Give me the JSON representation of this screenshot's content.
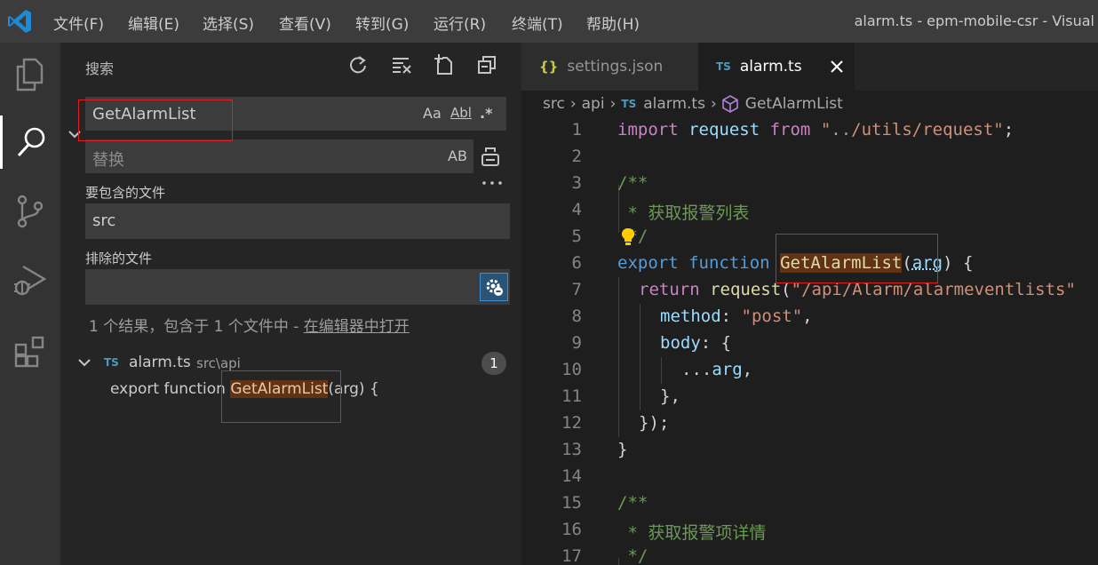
{
  "titlebar": {
    "menu": [
      "文件(F)",
      "编辑(E)",
      "选择(S)",
      "查看(V)",
      "转到(G)",
      "运行(R)",
      "终端(T)",
      "帮助(H)"
    ],
    "window_title": "alarm.ts - epm-mobile-csr - Visual"
  },
  "sidebar": {
    "title": "搜索",
    "search_value": "GetAlarmList",
    "search_options": {
      "match_case": "Aa",
      "whole_word": "Abl",
      "regex": ".*"
    },
    "replace_placeholder": "替换",
    "preserve_case": "AB",
    "include_label": "要包含的文件",
    "include_value": "src",
    "exclude_label": "排除的文件",
    "exclude_value": "",
    "results_message": "1 个结果，包含于 1 个文件中 - ",
    "open_in_editor": "在编辑器中打开",
    "result_file": {
      "badge": "TS",
      "name": "alarm.ts",
      "path": "src\\api",
      "count": "1"
    },
    "match": {
      "before": "export function ",
      "match": "GetAlarmList",
      "after": "(arg) {"
    }
  },
  "editor": {
    "tabs": [
      {
        "icon": "{}",
        "label": "settings.json"
      },
      {
        "icon": "TS",
        "label": "alarm.ts"
      }
    ],
    "breadcrumb": {
      "seg1": "src",
      "seg2": "api",
      "badge": "TS",
      "seg3": "alarm.ts",
      "seg4": "GetAlarmList"
    },
    "lines": [
      {
        "n": "1",
        "t": {
          "a": "import",
          "b": " request ",
          "c": "from",
          "d": " ",
          "e": "\"../utils/request\"",
          "f": ";"
        }
      },
      {
        "n": "2"
      },
      {
        "n": "3",
        "t": "/**"
      },
      {
        "n": "4",
        "t": " * 获取报警列表"
      },
      {
        "n": "5",
        "t": " */"
      },
      {
        "n": "6",
        "t": {
          "a": "export",
          "b": " ",
          "c": "function",
          "d": " ",
          "e": "GetAlarmList",
          "f": "(",
          "g": "arg",
          "h": ") {"
        }
      },
      {
        "n": "7",
        "t": {
          "a": "return",
          "b": " ",
          "c": "request",
          "d": "(",
          "e": "\"/api/Alarm/alarmeventlists\""
        }
      },
      {
        "n": "8",
        "t": {
          "a": "method",
          "b": ": ",
          "c": "\"post\"",
          "d": ","
        }
      },
      {
        "n": "9",
        "t": {
          "a": "body",
          "b": ": {"
        }
      },
      {
        "n": "10",
        "t": {
          "a": "...",
          "b": "arg",
          "c": ","
        }
      },
      {
        "n": "11",
        "t": "},"
      },
      {
        "n": "12",
        "t": "});"
      },
      {
        "n": "13",
        "t": "}"
      },
      {
        "n": "14"
      },
      {
        "n": "15",
        "t": "/**"
      },
      {
        "n": "16",
        "t": " * 获取报警项详情"
      },
      {
        "n": "17",
        "t": " */"
      }
    ]
  },
  "colors": {
    "accent": "#007acc",
    "highlight": "#613214",
    "annotation": "#e02020"
  }
}
